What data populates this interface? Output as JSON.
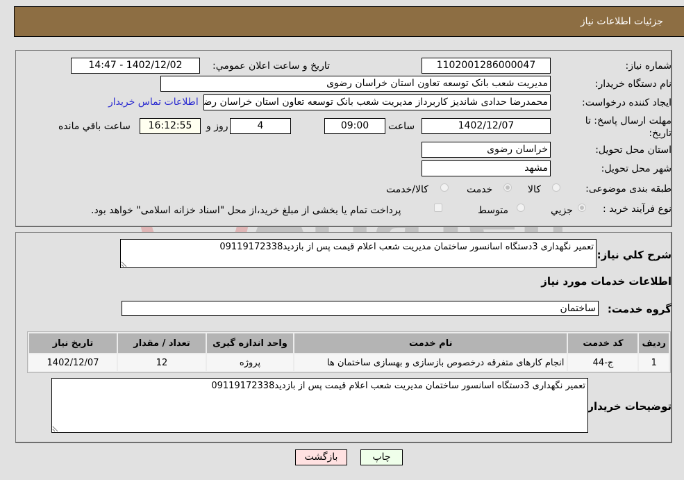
{
  "header": {
    "title": "جزئیات اطلاعات نیاز"
  },
  "form": {
    "need_number": {
      "label": "شماره نیاز:",
      "value": "1102001286000047"
    },
    "announce_datetime": {
      "label": "تاریخ و ساعت اعلان عمومي:",
      "value": "1402/12/02 - 14:47"
    },
    "buyer_org": {
      "label": "نام دستگاه خريدار:",
      "value": "مدیریت شعب بانک توسعه تعاون استان خراسان رضوی"
    },
    "requester": {
      "label": "ايجاد کننده درخواست:",
      "value": "محمدرضا حدادی شاندیز کاربرداز مدیریت شعب بانک توسعه تعاون استان خراسان رضوی",
      "contact_link": "اطلاعات تماس خريدار"
    },
    "deadline": {
      "label": "مهلت ارسال پاسخ: تا تاریخ:",
      "date": "1402/12/07",
      "time_label": "ساعت",
      "time": "09:00",
      "days": "4",
      "days_label": "روز و",
      "remaining": "16:12:55",
      "remaining_label": "ساعت باقي مانده"
    },
    "delivery_province": {
      "label": "استان محل تحویل:",
      "value": "خراسان رضوی"
    },
    "delivery_city": {
      "label": "شهر محل تحویل:",
      "value": "مشهد"
    },
    "category": {
      "label": "طبقه بندی موضوعی:",
      "options": [
        {
          "label": "کالا",
          "selected": false
        },
        {
          "label": "خدمت",
          "selected": true
        },
        {
          "label": "کالا/خدمت",
          "selected": false
        }
      ]
    },
    "purchase_type": {
      "label": "نوع فرآيند خريد :",
      "options": [
        {
          "label": "جزيي",
          "selected": true
        },
        {
          "label": "متوسط",
          "selected": false
        }
      ],
      "treasury_note": "پرداخت تمام يا بخشی از مبلغ خريد،از محل \"اسناد خزانه اسلامی\" خواهد بود.",
      "treasury_checked": false
    }
  },
  "details": {
    "description_label": "شرح كلي نياز:",
    "description": "تعمیر نگهداری 3دستگاه اسانسور ساختمان مدیریت شعب اعلام قیمت پس از بازدید09119172338",
    "services_heading": "اطلاعات خدمات مورد نياز",
    "service_group_label": "گروه خدمت:",
    "service_group": "ساختمان",
    "table": {
      "headers": [
        "رديف",
        "کد خدمت",
        "نام خدمت",
        "واحد اندازه گيری",
        "تعداد / مقدار",
        "تاريخ نياز"
      ],
      "rows": [
        [
          "1",
          "ج-44",
          "انجام کارهای متفرقه درخصوص بازسازی و بهسازی ساختمان ها",
          "پروژه",
          "12",
          "1402/12/07"
        ]
      ]
    },
    "buyer_notes_label": "توضيحات خريدار:",
    "buyer_notes": "تعمیر نگهداری 3دستگاه اسانسور ساختمان مدیریت شعب اعلام قیمت پس از بازدید09119172338"
  },
  "buttons": {
    "print": "چاپ",
    "back": "بازگشت"
  },
  "colors": {
    "header_bg": "#8d6e43",
    "print_bg": "#efffea",
    "back_bg": "#ffe1e1",
    "link": "#2a2ad0"
  }
}
